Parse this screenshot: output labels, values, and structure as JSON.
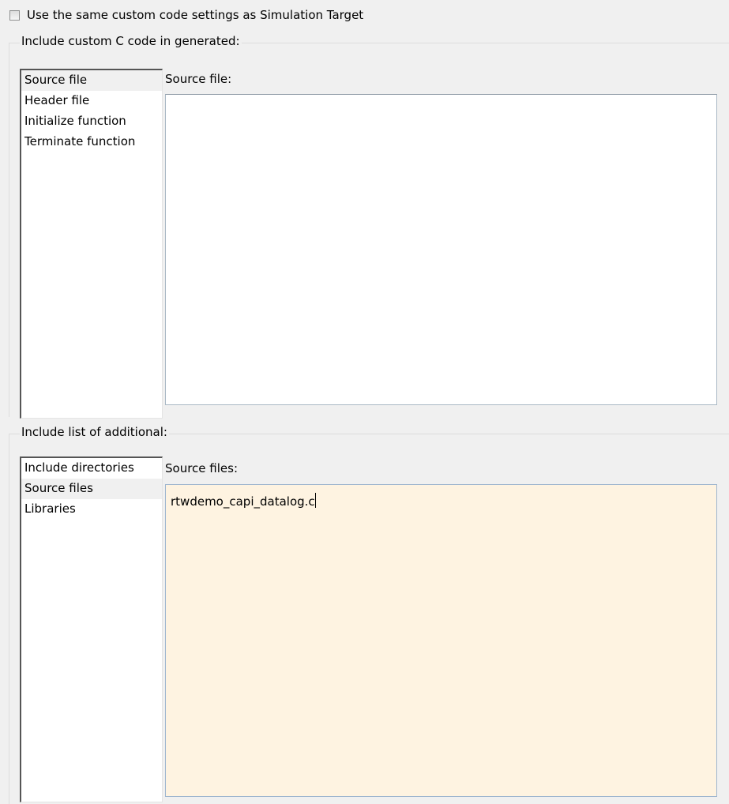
{
  "options": {
    "same_settings_checkbox": {
      "label": "Use the same custom code settings as Simulation Target",
      "checked": false
    }
  },
  "custom_code": {
    "legend": "Include custom C code in generated:",
    "items": [
      {
        "label": "Source file",
        "selected": true
      },
      {
        "label": "Header file",
        "selected": false
      },
      {
        "label": "Initialize function",
        "selected": false
      },
      {
        "label": "Terminate function",
        "selected": false
      }
    ],
    "pane_label": "Source file:",
    "content": ""
  },
  "additional": {
    "legend": "Include list of additional:",
    "items": [
      {
        "label": "Include directories",
        "selected": false
      },
      {
        "label": "Source files",
        "selected": true
      },
      {
        "label": "Libraries",
        "selected": false
      }
    ],
    "pane_label": "Source files:",
    "content": "rtwdemo_capi_datalog.c"
  },
  "colors": {
    "window_background": "#f0f0f0",
    "active_editor_background": "#fef3e1"
  }
}
